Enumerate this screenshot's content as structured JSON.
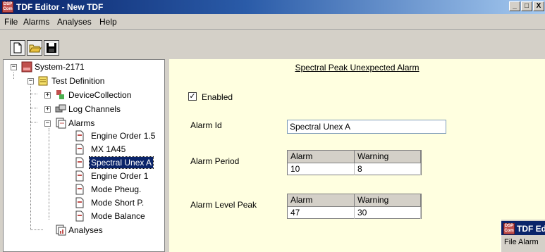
{
  "window": {
    "title": "TDF Editor - New TDF",
    "app_icon_text": "DSP Com",
    "minimize_label": "_",
    "maximize_label": "□",
    "close_label": "X"
  },
  "menu": {
    "items": [
      "File",
      "Alarms",
      "Analyses",
      "Help"
    ]
  },
  "toolbar": {
    "buttons": [
      "new-document",
      "open-folder",
      "save"
    ]
  },
  "tree": {
    "root": "System-2171",
    "test_definition": "Test Definition",
    "device_collection": "DeviceCollection",
    "log_channels": "Log Channels",
    "alarms": "Alarms",
    "alarm_items": [
      "Engine Order 1.5",
      "MX 1A45",
      "Spectral Unex A",
      "Engine Order 1",
      "Mode Pheug.",
      "Mode Short P.",
      "Mode Balance"
    ],
    "analyses": "Analyses",
    "selected": "Spectral Unex A",
    "expand_collapsed": "+",
    "expand_open": "−"
  },
  "detail": {
    "title": "Spectral Peak Unexpected Alarm",
    "enabled_label": "Enabled",
    "enabled_checked": true,
    "check_mark": "✓",
    "alarm_id_label": "Alarm Id",
    "alarm_id_value": "Spectral Unex A",
    "alarm_period_label": "Alarm Period",
    "alarm_level_peak_label": "Alarm Level Peak",
    "period_grid": {
      "headers": [
        "Alarm",
        "Warning"
      ],
      "values": [
        "10",
        "8"
      ]
    },
    "level_grid": {
      "headers": [
        "Alarm",
        "Warning"
      ],
      "values": [
        "47",
        "30"
      ]
    }
  },
  "second_window": {
    "title": "TDF Edi",
    "menu_items": [
      "File",
      "Alarm"
    ]
  },
  "colors": {
    "titlebar": "#0a246a",
    "selection": "#0a246a",
    "panel_bg": "#ffffe0",
    "chrome": "#d4d0c8"
  }
}
